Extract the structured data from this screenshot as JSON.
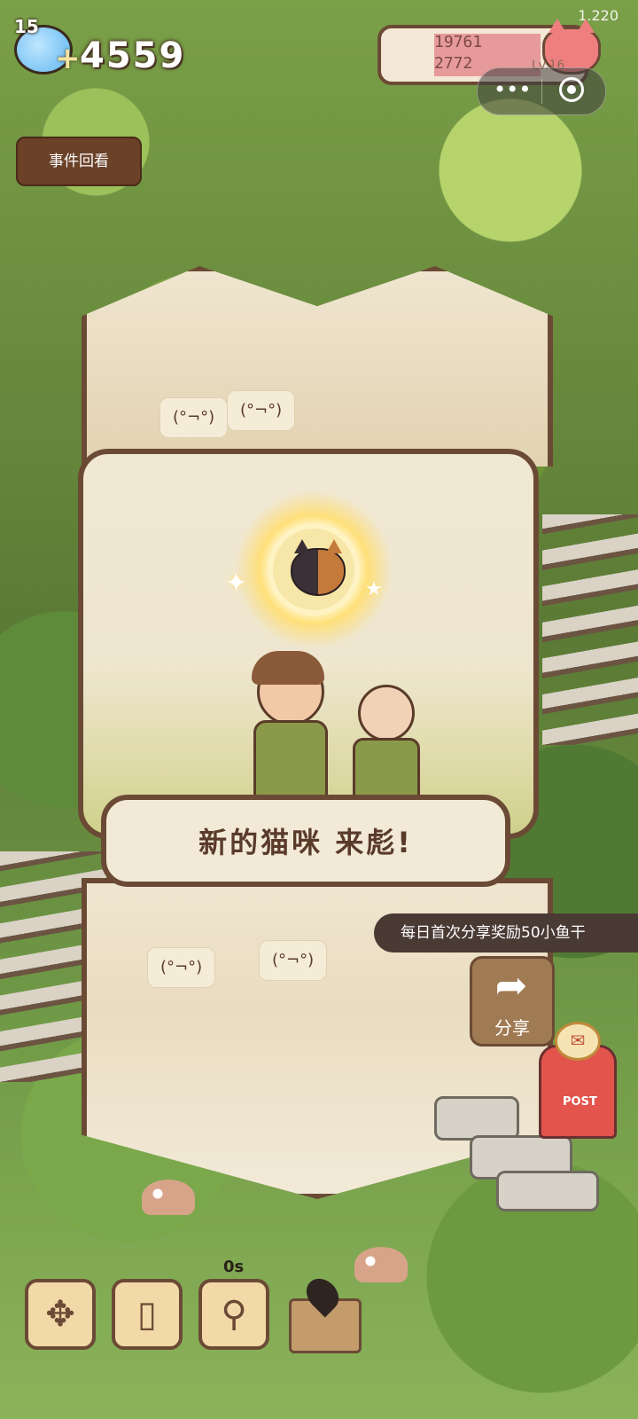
{
  "hud": {
    "level": "15",
    "coins": "4559",
    "version": "1.220",
    "xp_current": "19761",
    "xp_total": "2772",
    "player_level": "Lv.16",
    "event_review": "事件回看"
  },
  "miniprogram": {
    "menu_icon": "ellipsis-icon",
    "close_icon": "target-icon"
  },
  "emotes": [
    "(°¬°)",
    "(°¬°)",
    "(°¬°)",
    "(°¬°)"
  ],
  "popup": {
    "message": "新的猫咪 来彪!"
  },
  "share": {
    "tip": "每日首次分享奖励50小鱼干",
    "label": "分享"
  },
  "mailbox": {
    "label": "POST"
  },
  "toolbar": {
    "timer": "0s",
    "items": [
      "move-icon",
      "phone-icon",
      "scoop-icon",
      "map-icon"
    ]
  }
}
